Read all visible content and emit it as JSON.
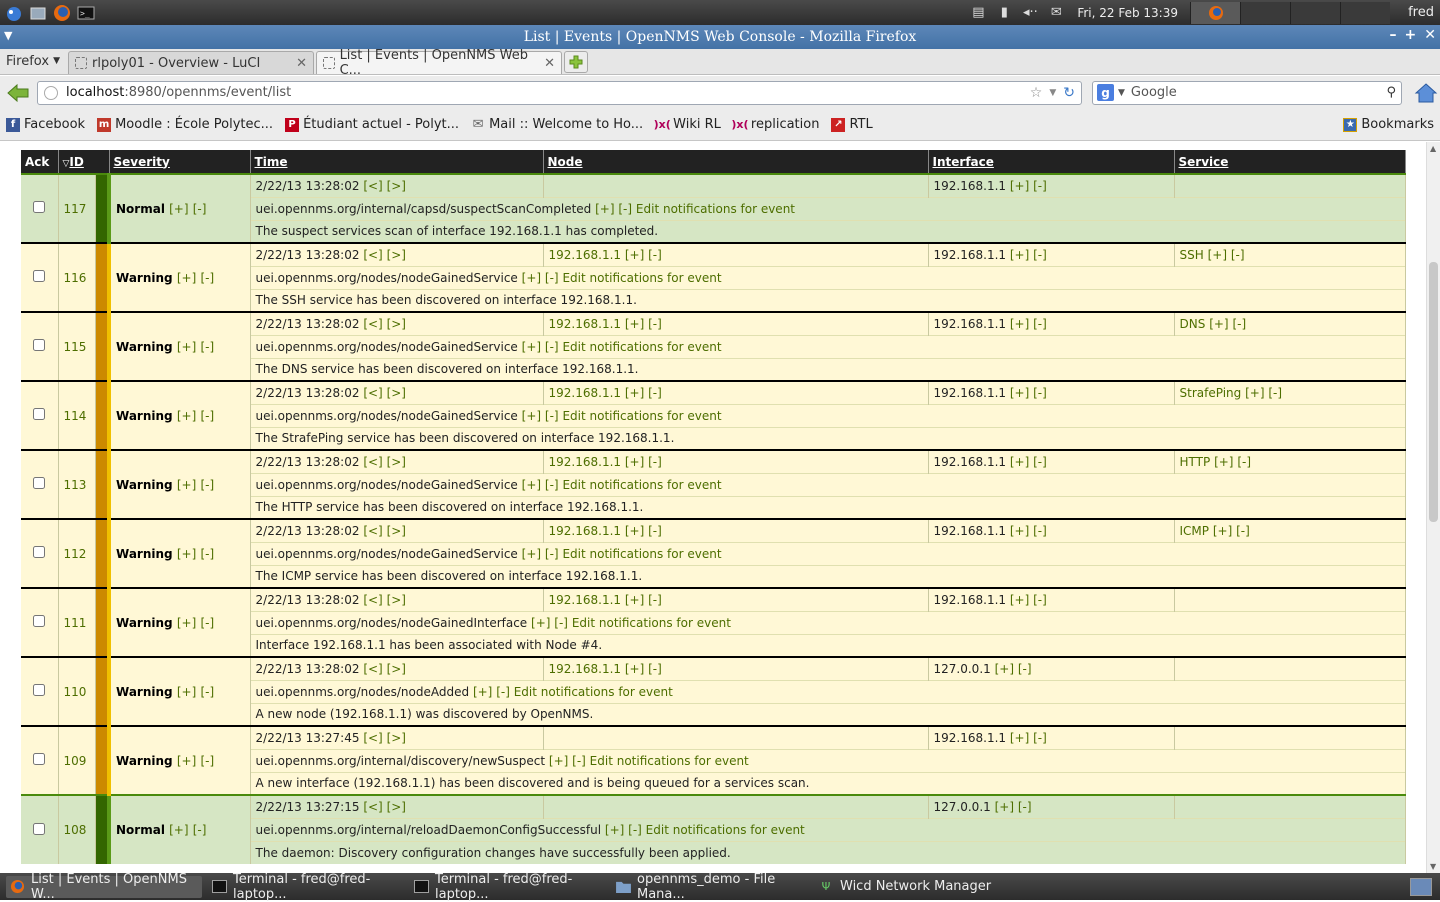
{
  "system_panel": {
    "clock": "Fri, 22 Feb  13:39",
    "user": "fred"
  },
  "window": {
    "title": "List | Events | OpenNMS Web Console - Mozilla Firefox"
  },
  "browser": {
    "menu_label": "Firefox",
    "tabs": [
      {
        "label": "rlpoly01 - Overview - LuCI",
        "active": false
      },
      {
        "label": "List | Events | OpenNMS Web C...",
        "active": true
      }
    ],
    "url_host": "localhost",
    "url_path": ":8980/opennms/event/list",
    "search_placeholder": "Google",
    "bookmarks": [
      {
        "label": "Facebook",
        "icon": "facebook-icon",
        "color": "#3b5998"
      },
      {
        "label": "Moodle : École Polytec...",
        "icon": "moodle-icon",
        "color": "#c0392b"
      },
      {
        "label": "Étudiant actuel - Polyt...",
        "icon": "polytechnique-icon",
        "color": "#c0001a"
      },
      {
        "label": "Mail :: Welcome to Ho...",
        "icon": "mail-icon",
        "color": "#666666"
      },
      {
        "label": "Wiki RL",
        "icon": "wiki-icon",
        "color": "#b0005a"
      },
      {
        "label": "replication",
        "icon": "replication-icon",
        "color": "#b0005a"
      },
      {
        "label": "RTL",
        "icon": "rtl-icon",
        "color": "#cc2222"
      }
    ],
    "bookmarks_menu": "Bookmarks"
  },
  "table": {
    "headers": {
      "ack": "Ack",
      "id_sort": "▽",
      "id": "ID",
      "severity": "Severity",
      "time": "Time",
      "node": "Node",
      "interface": "Interface",
      "service": "Service"
    },
    "events": [
      {
        "id": "117",
        "severity": "Normal",
        "time": "2/22/13 13:28:02",
        "node": "",
        "interface": "192.168.1.1",
        "service": "",
        "uei": "uei.opennms.org/internal/capsd/suspectScanCompleted",
        "description": "The suspect services scan of interface 192.168.1.1 has completed."
      },
      {
        "id": "116",
        "severity": "Warning",
        "time": "2/22/13 13:28:02",
        "node": "192.168.1.1",
        "interface": "192.168.1.1",
        "service": "SSH",
        "uei": "uei.opennms.org/nodes/nodeGainedService",
        "description": "The SSH service has been discovered on interface 192.168.1.1."
      },
      {
        "id": "115",
        "severity": "Warning",
        "time": "2/22/13 13:28:02",
        "node": "192.168.1.1",
        "interface": "192.168.1.1",
        "service": "DNS",
        "uei": "uei.opennms.org/nodes/nodeGainedService",
        "description": "The DNS service has been discovered on interface 192.168.1.1."
      },
      {
        "id": "114",
        "severity": "Warning",
        "time": "2/22/13 13:28:02",
        "node": "192.168.1.1",
        "interface": "192.168.1.1",
        "service": "StrafePing",
        "uei": "uei.opennms.org/nodes/nodeGainedService",
        "description": "The StrafePing service has been discovered on interface 192.168.1.1."
      },
      {
        "id": "113",
        "severity": "Warning",
        "time": "2/22/13 13:28:02",
        "node": "192.168.1.1",
        "interface": "192.168.1.1",
        "service": "HTTP",
        "uei": "uei.opennms.org/nodes/nodeGainedService",
        "description": "The HTTP service has been discovered on interface 192.168.1.1."
      },
      {
        "id": "112",
        "severity": "Warning",
        "time": "2/22/13 13:28:02",
        "node": "192.168.1.1",
        "interface": "192.168.1.1",
        "service": "ICMP",
        "uei": "uei.opennms.org/nodes/nodeGainedService",
        "description": "The ICMP service has been discovered on interface 192.168.1.1."
      },
      {
        "id": "111",
        "severity": "Warning",
        "time": "2/22/13 13:28:02",
        "node": "192.168.1.1",
        "interface": "192.168.1.1",
        "service": "",
        "uei": "uei.opennms.org/nodes/nodeGainedInterface",
        "description": "Interface 192.168.1.1 has been associated with Node #4."
      },
      {
        "id": "110",
        "severity": "Warning",
        "time": "2/22/13 13:28:02",
        "node": "192.168.1.1",
        "interface": "127.0.0.1",
        "service": "",
        "uei": "uei.opennms.org/nodes/nodeAdded",
        "description": "A new node (192.168.1.1) was discovered by OpenNMS."
      },
      {
        "id": "109",
        "severity": "Warning",
        "time": "2/22/13 13:27:45",
        "node": "",
        "interface": "192.168.1.1",
        "service": "",
        "uei": "uei.opennms.org/internal/discovery/newSuspect",
        "description": "A new interface (192.168.1.1) has been discovered and is being queued for a services scan."
      },
      {
        "id": "108",
        "severity": "Normal",
        "time": "2/22/13 13:27:15",
        "node": "",
        "interface": "127.0.0.1",
        "service": "",
        "uei": "uei.opennms.org/internal/reloadDaemonConfigSuccessful",
        "description": "The daemon: Discovery configuration changes have successfully been applied."
      }
    ],
    "plus": "[+]",
    "minus": "[-]",
    "prev": "[<]",
    "next": "[>]",
    "edit_notifications": "Edit notifications for event"
  },
  "colors": {
    "normal_row": "#d6e6c4",
    "warning_row": "#fff8d6",
    "link": "#4d6e00"
  },
  "taskbar": {
    "tasks": [
      {
        "label": "List | Events | OpenNMS W...",
        "icon": "firefox-icon",
        "active": true
      },
      {
        "label": "Terminal - fred@fred-laptop...",
        "icon": "terminal-icon",
        "active": false
      },
      {
        "label": "Terminal - fred@fred-laptop...",
        "icon": "terminal-icon",
        "active": false
      },
      {
        "label": "opennms_demo - File Mana...",
        "icon": "folder-icon",
        "active": false
      },
      {
        "label": "Wicd Network Manager",
        "icon": "wicd-icon",
        "active": false
      }
    ]
  }
}
